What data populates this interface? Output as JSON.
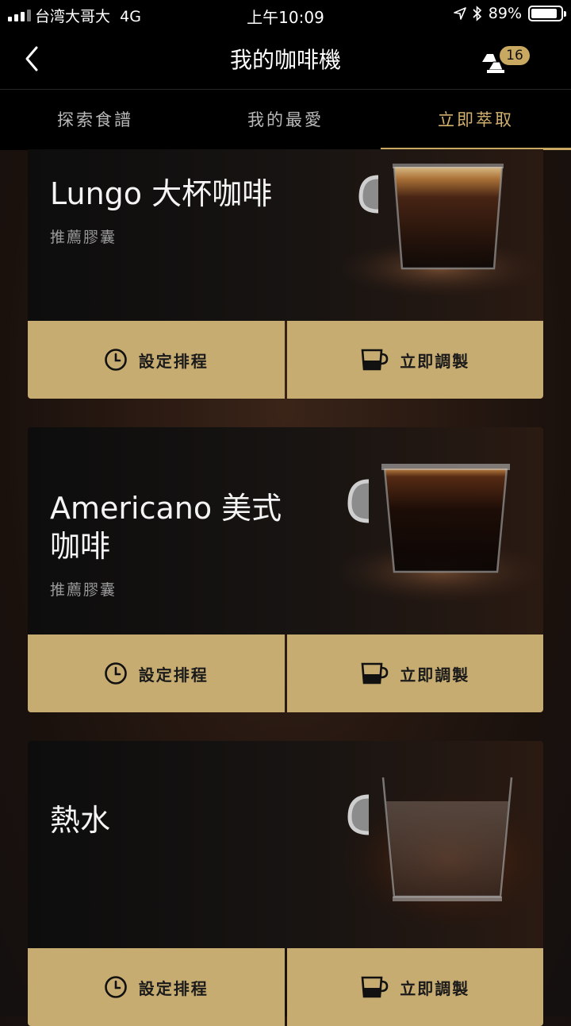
{
  "status_bar": {
    "carrier": "台湾大哥大",
    "network": "4G",
    "time": "上午10:09",
    "battery_percent": "89%",
    "battery_level": 0.89
  },
  "navbar": {
    "title": "我的咖啡機",
    "capsule_count": "16"
  },
  "tabs": [
    {
      "label": "探索食譜",
      "active": false
    },
    {
      "label": "我的最愛",
      "active": false
    },
    {
      "label": "立即萃取",
      "active": true
    }
  ],
  "recipes": [
    {
      "name": "Lungo 大杯咖啡",
      "subtitle": "推薦膠囊",
      "schedule_label": "設定排程",
      "brew_label": "立即調製"
    },
    {
      "name": "Americano 美式咖啡",
      "subtitle": "推薦膠囊",
      "schedule_label": "設定排程",
      "brew_label": "立即調製"
    },
    {
      "name": "熱水",
      "subtitle": "",
      "schedule_label": "設定排程",
      "brew_label": "立即調製"
    }
  ],
  "colors": {
    "accent_gold": "#c9a961",
    "button_bg": "#c7ac72",
    "background": "#1a110d"
  }
}
